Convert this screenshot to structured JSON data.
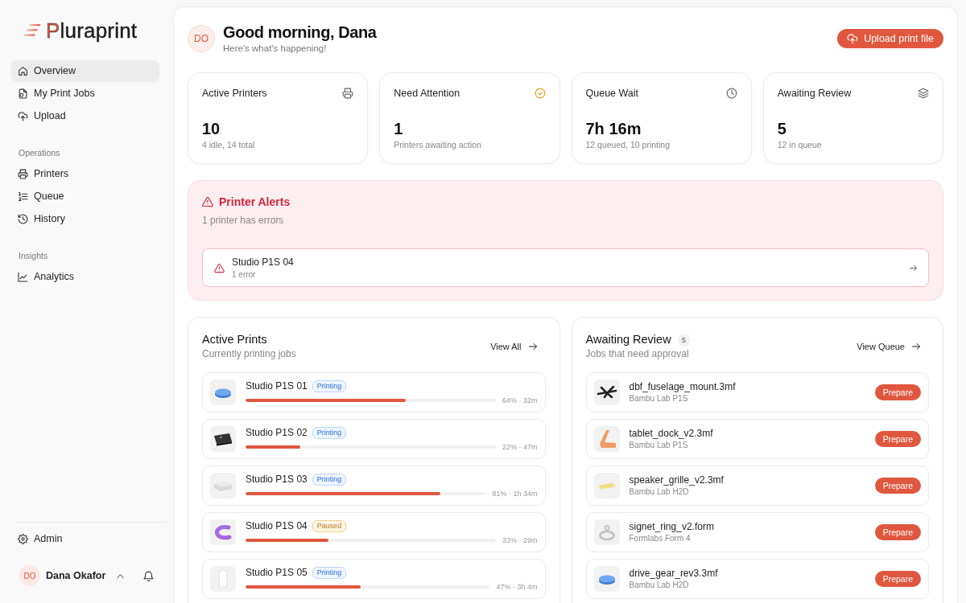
{
  "sidebar": {
    "logo": "Pluraprint",
    "nav": [
      {
        "label": "Overview",
        "selected": true
      },
      {
        "label": "My Print Jobs",
        "selected": false
      },
      {
        "label": "Upload",
        "selected": false
      }
    ],
    "sections": [
      {
        "heading": "Operations",
        "items": [
          {
            "label": "Printers",
            "selected": false
          },
          {
            "label": "Queue",
            "selected": false
          },
          {
            "label": "History",
            "selected": false
          }
        ]
      },
      {
        "heading": "Insights",
        "items": [
          {
            "label": "Analytics",
            "selected": false
          }
        ]
      }
    ],
    "admin": {
      "label": "Admin",
      "selected": false
    },
    "user": {
      "initials": "DO",
      "name": "Dana Okafor"
    }
  },
  "header": {
    "initials": "DO",
    "greeting": "Good morning, Dana",
    "subtitle": "Here's what's happening!",
    "upload_button": "Upload print file"
  },
  "stats": [
    {
      "label": "Active Printers",
      "value": "10",
      "detail": "4 idle, 14 total"
    },
    {
      "label": "Need Attention",
      "value": "1",
      "detail": "Printers awaiting action"
    },
    {
      "label": "Queue Wait",
      "value": "7h 16m",
      "detail": "12 queued, 10 printing"
    },
    {
      "label": "Awaiting Review",
      "value": "5",
      "detail": "12 in queue"
    }
  ],
  "alerts": {
    "title": "Printer Alerts",
    "summary": "1 printer has errors",
    "items": [
      {
        "name": "Studio P1S 04",
        "detail": "1 error"
      }
    ]
  },
  "active_prints": {
    "title": "Active Prints",
    "subtitle": "Currently printing jobs",
    "link": "View All",
    "rows": [
      {
        "name": "Studio P1S 01",
        "status": "Printing",
        "paused": false,
        "level": 0.64,
        "reading": "64% · 32m"
      },
      {
        "name": "Studio P1S 02",
        "status": "Printing",
        "paused": false,
        "level": 0.22,
        "reading": "22% · 47m"
      },
      {
        "name": "Studio P1S 03",
        "status": "Printing",
        "paused": false,
        "level": 0.81,
        "reading": "81% · 1h 34m"
      },
      {
        "name": "Studio P1S 04",
        "status": "Paused",
        "paused": true,
        "level": 0.33,
        "reading": "33% · 29m"
      },
      {
        "name": "Studio P1S 05",
        "status": "Printing",
        "paused": false,
        "level": 0.47,
        "reading": "47% · 3h 4m"
      }
    ]
  },
  "awaiting_review": {
    "title": "Awaiting Review",
    "count": "5",
    "subtitle": "Jobs that need approval",
    "link": "View Queue",
    "rows": [
      {
        "file": "dbf_fuselage_mount.3mf",
        "printer": "Bambu Lab P1S",
        "action": "Prepare"
      },
      {
        "file": "tablet_dock_v2.3mf",
        "printer": "Bambu Lab P1S",
        "action": "Prepare"
      },
      {
        "file": "speaker_grille_v2.3mf",
        "printer": "Bambu Lab H2D",
        "action": "Prepare"
      },
      {
        "file": "signet_ring_v2.form",
        "printer": "Formlabs Form 4",
        "action": "Prepare"
      },
      {
        "file": "drive_gear_rev3.3mf",
        "printer": "Bambu Lab H2D",
        "action": "Prepare"
      }
    ]
  }
}
